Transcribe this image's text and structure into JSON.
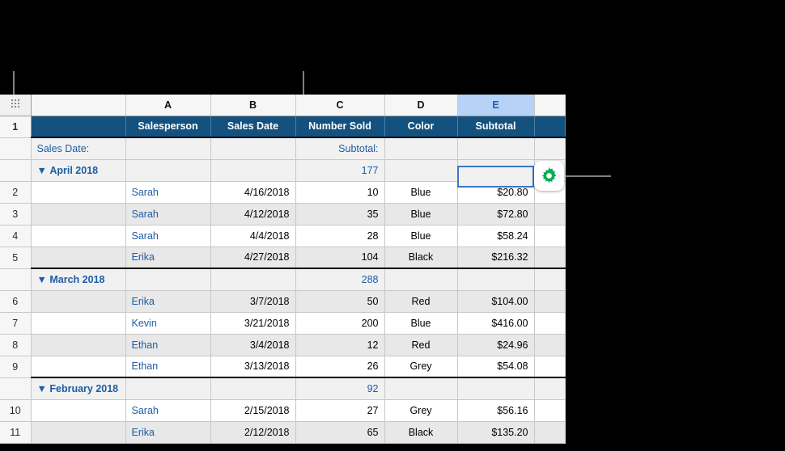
{
  "app": {
    "kind": "spreadsheet-table"
  },
  "colors": {
    "header_band": "#14517f",
    "accent_blue": "#1d5da5",
    "selection": "#b6d2f7",
    "gear_green": "#0aab55",
    "row_alt": "#e8e8e8",
    "group_row": "#f1f1f1"
  },
  "column_headers": {
    "corner_icon": "grid-dots-icon",
    "labels": [
      "",
      "A",
      "B",
      "C",
      "D",
      "E",
      ""
    ],
    "selected": "E"
  },
  "title_row": {
    "row_number": "1",
    "cells": [
      "",
      "Salesperson",
      "Sales Date",
      "Number Sold",
      "Color",
      "Subtotal",
      ""
    ]
  },
  "category_labels": {
    "group_by": "Sales Date:",
    "summary": "Subtotal:"
  },
  "groups": [
    {
      "name": "April 2018",
      "disclosure": "▼",
      "subtotal": "177",
      "selected": true,
      "rows": [
        {
          "num": "2",
          "salesperson": "Sarah",
          "date": "4/16/2018",
          "sold": "10",
          "color": "Blue",
          "subtotal": "$20.80"
        },
        {
          "num": "3",
          "salesperson": "Sarah",
          "date": "4/12/2018",
          "sold": "35",
          "color": "Blue",
          "subtotal": "$72.80"
        },
        {
          "num": "4",
          "salesperson": "Sarah",
          "date": "4/4/2018",
          "sold": "28",
          "color": "Blue",
          "subtotal": "$58.24"
        },
        {
          "num": "5",
          "salesperson": "Erika",
          "date": "4/27/2018",
          "sold": "104",
          "color": "Black",
          "subtotal": "$216.32"
        }
      ]
    },
    {
      "name": "March 2018",
      "disclosure": "▼",
      "subtotal": "288",
      "selected": false,
      "rows": [
        {
          "num": "6",
          "salesperson": "Erika",
          "date": "3/7/2018",
          "sold": "50",
          "color": "Red",
          "subtotal": "$104.00"
        },
        {
          "num": "7",
          "salesperson": "Kevin",
          "date": "3/21/2018",
          "sold": "200",
          "color": "Blue",
          "subtotal": "$416.00"
        },
        {
          "num": "8",
          "salesperson": "Ethan",
          "date": "3/4/2018",
          "sold": "12",
          "color": "Red",
          "subtotal": "$24.96"
        },
        {
          "num": "9",
          "salesperson": "Ethan",
          "date": "3/13/2018",
          "sold": "26",
          "color": "Grey",
          "subtotal": "$54.08"
        }
      ]
    },
    {
      "name": "February 2018",
      "disclosure": "▼",
      "subtotal": "92",
      "selected": false,
      "rows": [
        {
          "num": "10",
          "salesperson": "Sarah",
          "date": "2/15/2018",
          "sold": "27",
          "color": "Grey",
          "subtotal": "$56.16"
        },
        {
          "num": "11",
          "salesperson": "Erika",
          "date": "2/12/2018",
          "sold": "65",
          "color": "Black",
          "subtotal": "$135.20"
        }
      ]
    }
  ],
  "gear_popover": {
    "icon": "gear-icon"
  }
}
